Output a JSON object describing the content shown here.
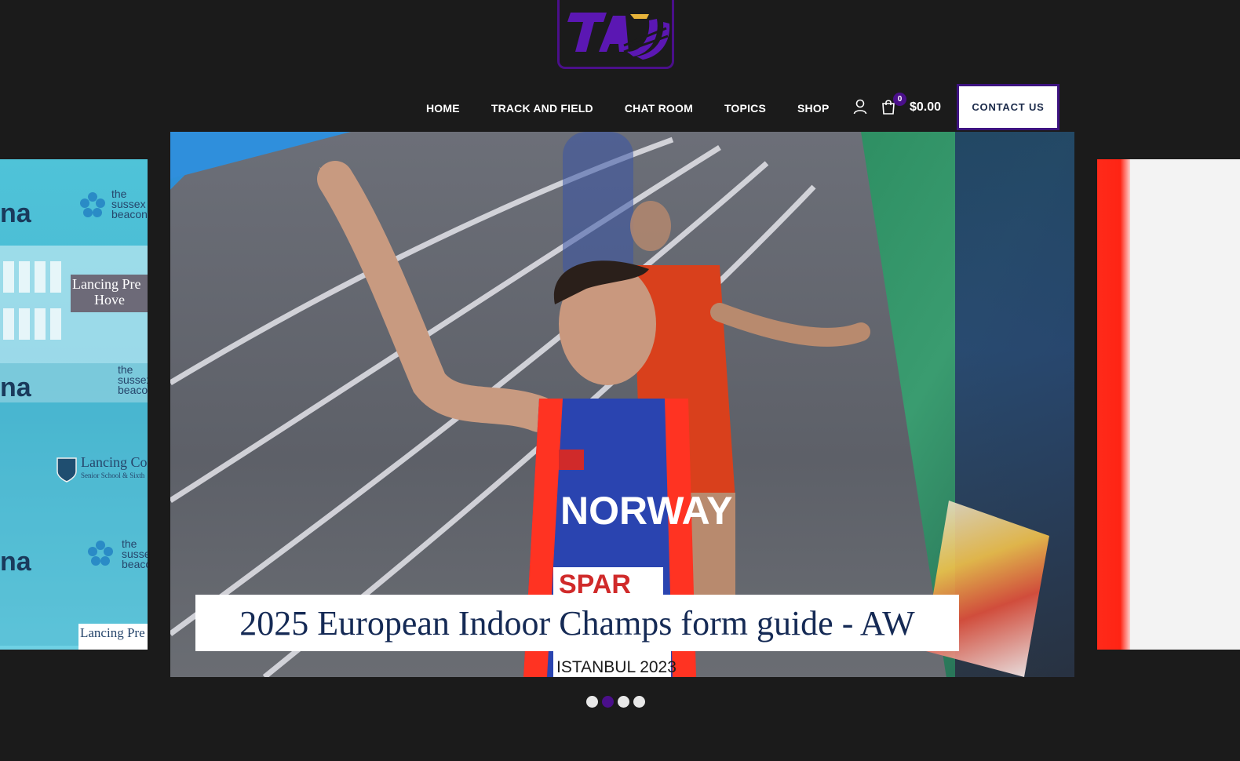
{
  "brand": {
    "logo_text": "TAF",
    "accent_color": "#4a0f8a",
    "secondary_color": "#e6b33a"
  },
  "nav": {
    "items": [
      {
        "label": "HOME"
      },
      {
        "label": "TRACK AND FIELD"
      },
      {
        "label": "CHAT ROOM"
      },
      {
        "label": "TOPICS"
      },
      {
        "label": "SHOP"
      }
    ]
  },
  "header": {
    "user_icon": "user-icon",
    "cart_icon": "shopping-bag-icon",
    "cart_count": "0",
    "cart_total": "$0.00",
    "contact_label": "CONTACT US"
  },
  "slider": {
    "current_caption": "2025 European Indoor Champs form guide - AW",
    "jersey_text": "NORWAY",
    "bib_brand": "SPAR",
    "bib_event": "ISTANBUL 2023",
    "left_slide": {
      "texts": [
        "the",
        "sussex",
        "beacon",
        "Lancing Pre",
        "Hove",
        "Lancing Co",
        "Senior School & Sixth",
        "na"
      ]
    },
    "dots_count": 4,
    "active_dot": 1
  }
}
